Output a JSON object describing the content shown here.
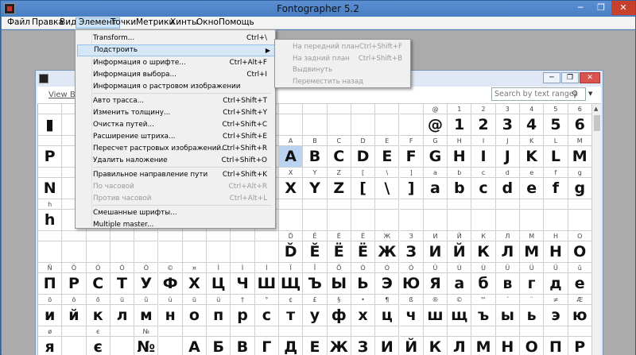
{
  "app": {
    "title": "Fontographer 5.2",
    "min_label": "─",
    "max_label": "❐",
    "close_label": "✕"
  },
  "menubar": {
    "items": [
      "Файл",
      "Правка",
      "Вид",
      "Элемент",
      "Точки",
      "Метрики",
      "Хинты",
      "Окно",
      "Помощь"
    ],
    "active_index": 3
  },
  "child": {
    "view_by_label": "View By:",
    "search_placeholder": "Search by text ranges",
    "min_label": "─",
    "max_label": "❐",
    "close_label": "✕"
  },
  "element_menu": {
    "items": [
      {
        "label": "Transform...",
        "shortcut": "Ctrl+\\",
        "disabled": false
      },
      {
        "label": "Подстроить",
        "shortcut": "",
        "disabled": false,
        "submenu": true
      },
      {
        "label": "Информация о шрифте...",
        "shortcut": "Ctrl+Alt+F",
        "disabled": false
      },
      {
        "label": "Информация выбора...",
        "shortcut": "Ctrl+I",
        "disabled": false
      },
      {
        "label": "Информация о растровом изображении",
        "shortcut": "",
        "disabled": false
      },
      {
        "label": "Авто трасса...",
        "shortcut": "Ctrl+Shift+T",
        "disabled": false
      },
      {
        "label": "Изменить толщину...",
        "shortcut": "Ctrl+Shift+Y",
        "disabled": false
      },
      {
        "label": "Очистка путей...",
        "shortcut": "Ctrl+Shift+C",
        "disabled": false
      },
      {
        "label": "Расширение штриха...",
        "shortcut": "Ctrl+Shift+E",
        "disabled": false
      },
      {
        "label": "Пересчет растровых изображений...",
        "shortcut": "Ctrl+Shift+R",
        "disabled": false
      },
      {
        "label": "Удалить наложение",
        "shortcut": "Ctrl+Shift+O",
        "disabled": false
      },
      {
        "label": "Правильное направление пути",
        "shortcut": "Ctrl+Shift+K",
        "disabled": false
      },
      {
        "label": "По часовой",
        "shortcut": "Ctrl+Alt+R",
        "disabled": true
      },
      {
        "label": "Против часовой",
        "shortcut": "Ctrl+Alt+L",
        "disabled": true
      },
      {
        "label": "Смешанные шрифты...",
        "shortcut": "",
        "disabled": false
      },
      {
        "label": "Multiple master...",
        "shortcut": "",
        "disabled": false
      }
    ]
  },
  "submenu": {
    "items": [
      {
        "label": "На передний план",
        "shortcut": "Ctrl+Shift+F"
      },
      {
        "label": "На задний план",
        "shortcut": "Ctrl+Shift+B"
      },
      {
        "label": "Выдвинуть",
        "shortcut": ""
      },
      {
        "label": "Переместить назад",
        "shortcut": ""
      }
    ]
  },
  "grid": {
    "rows": [
      {
        "labels": [
          "",
          "",
          "",
          "",
          "",
          "",
          "",
          "",
          "",
          "",
          "",
          "",
          "",
          "",
          "",
          "",
          "@",
          "1",
          "2",
          "3",
          "4",
          "5",
          "6"
        ],
        "glyphs": [
          "▮",
          "",
          "",
          "",
          "",
          "",
          "",
          "",
          "",
          "",
          "",
          "",
          "",
          "",
          "",
          "",
          "@",
          "1",
          "2",
          "3",
          "4",
          "5",
          "6"
        ]
      },
      {
        "labels": [
          "",
          "",
          "",
          "",
          "",
          "",
          "",
          "",
          "",
          "",
          "A",
          "B",
          "C",
          "D",
          "E",
          "F",
          "G",
          "H",
          "I",
          "J",
          "K",
          "L",
          "M"
        ],
        "glyphs": [
          "P",
          "",
          "",
          "",
          "",
          "",
          "",
          "",
          "",
          "",
          "A",
          "B",
          "C",
          "D",
          "E",
          "F",
          "G",
          "H",
          "I",
          "J",
          "K",
          "L",
          "M"
        ]
      },
      {
        "labels": [
          "",
          "",
          "",
          "",
          "",
          "",
          "",
          "",
          "",
          "",
          "X",
          "Y",
          "Z",
          "[",
          "\\",
          "]",
          "a",
          "b",
          "c",
          "d",
          "e",
          "f",
          "g"
        ],
        "glyphs": [
          "N",
          "",
          "",
          "",
          "",
          "",
          "",
          "",
          "",
          "",
          "X",
          "Y",
          "Z",
          "[",
          "\\",
          "]",
          "a",
          "b",
          "c",
          "d",
          "e",
          "f",
          "g"
        ]
      },
      {
        "labels": [
          "h",
          "",
          "",
          "",
          "",
          "",
          "",
          "",
          "",
          "",
          "",
          "",
          "",
          "",
          "",
          "",
          "",
          "",
          "",
          "",
          "",
          "",
          ""
        ],
        "glyphs": [
          "h",
          "",
          "",
          "",
          "",
          "",
          "",
          "",
          "",
          "",
          "",
          "",
          "",
          "",
          "",
          "",
          "",
          "",
          "",
          "",
          "",
          "",
          ""
        ]
      },
      {
        "labels": [
          "",
          "",
          "",
          "",
          "",
          "",
          "",
          "",
          "",
          "",
          "Ď",
          "Ě",
          "Ё",
          "Ё",
          "Ж",
          "З",
          "И",
          "Й",
          "К",
          "Л",
          "М",
          "Н",
          "О"
        ],
        "glyphs": [
          "",
          "",
          "",
          "",
          "",
          "",
          "",
          "",
          "",
          "",
          "Ď",
          "Ě",
          "Ё",
          "Ё",
          "Ж",
          "З",
          "И",
          "Й",
          "К",
          "Л",
          "М",
          "Н",
          "О"
        ]
      },
      {
        "labels": [
          "Ñ",
          "Ö",
          "Ó",
          "Ò",
          "Ò",
          "©",
          "¤",
          "Ì",
          "Ì",
          "Ì",
          "Ï",
          "Ĩ",
          "Õ",
          "Ò",
          "Ó",
          "Ó",
          "Û",
          "Ù",
          "Ù",
          "Ü",
          "Ü",
          "Ü",
          "û"
        ],
        "glyphs": [
          "П",
          "Р",
          "С",
          "Т",
          "У",
          "Ф",
          "Х",
          "Ц",
          "Ч",
          "Ш",
          "Щ",
          "Ъ",
          "Ы",
          "Ь",
          "Э",
          "Ю",
          "Я",
          "а",
          "б",
          "в",
          "г",
          "д",
          "е"
        ]
      },
      {
        "labels": [
          "ö",
          "ö",
          "õ",
          "ü",
          "û",
          "ù",
          "ū",
          "ü",
          "†",
          "°",
          "¢",
          "£",
          "§",
          "•",
          "¶",
          "ß",
          "®",
          "©",
          "™",
          "´",
          "¨",
          "≠",
          "Æ"
        ],
        "glyphs": [
          "и",
          "й",
          "к",
          "л",
          "м",
          "н",
          "о",
          "п",
          "р",
          "с",
          "т",
          "у",
          "ф",
          "х",
          "ц",
          "ч",
          "ш",
          "щ",
          "ъ",
          "ы",
          "ь",
          "э",
          "ю"
        ]
      },
      {
        "labels": [
          "ø",
          "",
          "є",
          "",
          "№",
          "",
          "",
          "",
          "",
          "",
          "",
          "",
          "",
          "",
          "",
          "",
          "",
          "",
          "",
          "",
          "",
          "",
          ""
        ],
        "glyphs": [
          "я",
          "",
          "є",
          "",
          "№",
          "",
          "А",
          "Б",
          "В",
          "Г",
          "Д",
          "Е",
          "Ж",
          "З",
          "И",
          "Й",
          "К",
          "Л",
          "М",
          "Н",
          "О",
          "П",
          "Р"
        ]
      }
    ]
  }
}
